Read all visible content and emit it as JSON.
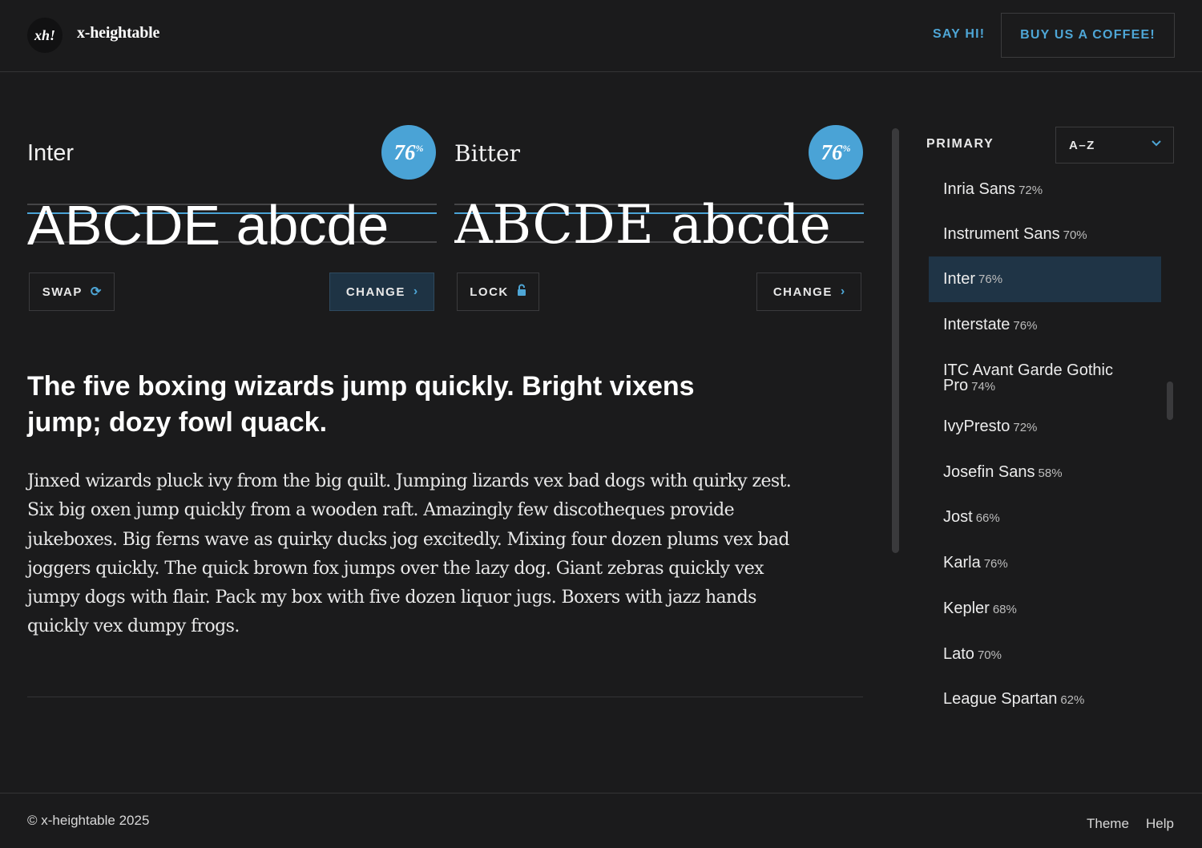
{
  "header": {
    "logo_badge": "xh!",
    "logo_text": "x-heightable",
    "say_hi": "SAY HI!",
    "coffee": "BUY US A COFFEE!"
  },
  "left_font": {
    "name": "Inter",
    "xheight": "76",
    "xheight_unit": "%",
    "specimen": "ABCDE abcde",
    "swap_label": "SWAP",
    "change_label": "CHANGE"
  },
  "right_font": {
    "name": "Bitter",
    "xheight": "76",
    "xheight_unit": "%",
    "specimen": "ABCDE abcde",
    "lock_label": "LOCK",
    "change_label": "CHANGE"
  },
  "preview": {
    "headline": "The five boxing wizards jump quickly. Bright vixens jump; dozy fowl quack.",
    "body": "Jinxed wizards pluck ivy from the big quilt. Jumping lizards vex bad dogs with quirky zest. Six big oxen jump quickly from a wooden raft. Amazingly few discotheques provide jukeboxes. Big ferns wave as quirky ducks jog excitedly. Mixing four dozen plums vex bad joggers quickly. The quick brown fox jumps over the lazy dog. Giant zebras quickly vex jumpy dogs with flair. Pack my box with five dozen liquor jugs. Boxers with jazz hands quickly vex dumpy frogs."
  },
  "sidebar": {
    "label": "PRIMARY",
    "sort_value": "A–Z",
    "fonts": [
      {
        "name": "Inria Sans",
        "pct": "72%"
      },
      {
        "name": "Instrument Sans",
        "pct": "70%"
      },
      {
        "name": "Inter",
        "pct": "76%",
        "selected": true
      },
      {
        "name": "Interstate",
        "pct": "76%"
      },
      {
        "name": "ITC Avant Garde Gothic Pro",
        "pct": "74%"
      },
      {
        "name": "IvyPresto",
        "pct": "72%"
      },
      {
        "name": "Josefin Sans",
        "pct": "58%"
      },
      {
        "name": "Jost",
        "pct": "66%"
      },
      {
        "name": "Karla",
        "pct": "76%"
      },
      {
        "name": "Kepler",
        "pct": "68%"
      },
      {
        "name": "Lato",
        "pct": "70%"
      },
      {
        "name": "League Spartan",
        "pct": "62%"
      }
    ]
  },
  "footer": {
    "copyright": "© x-heightable 2025",
    "theme": "Theme",
    "help": "Help"
  },
  "colors": {
    "background": "#1b1b1c",
    "accent": "#4aa3d6",
    "selected": "#1f3446"
  }
}
